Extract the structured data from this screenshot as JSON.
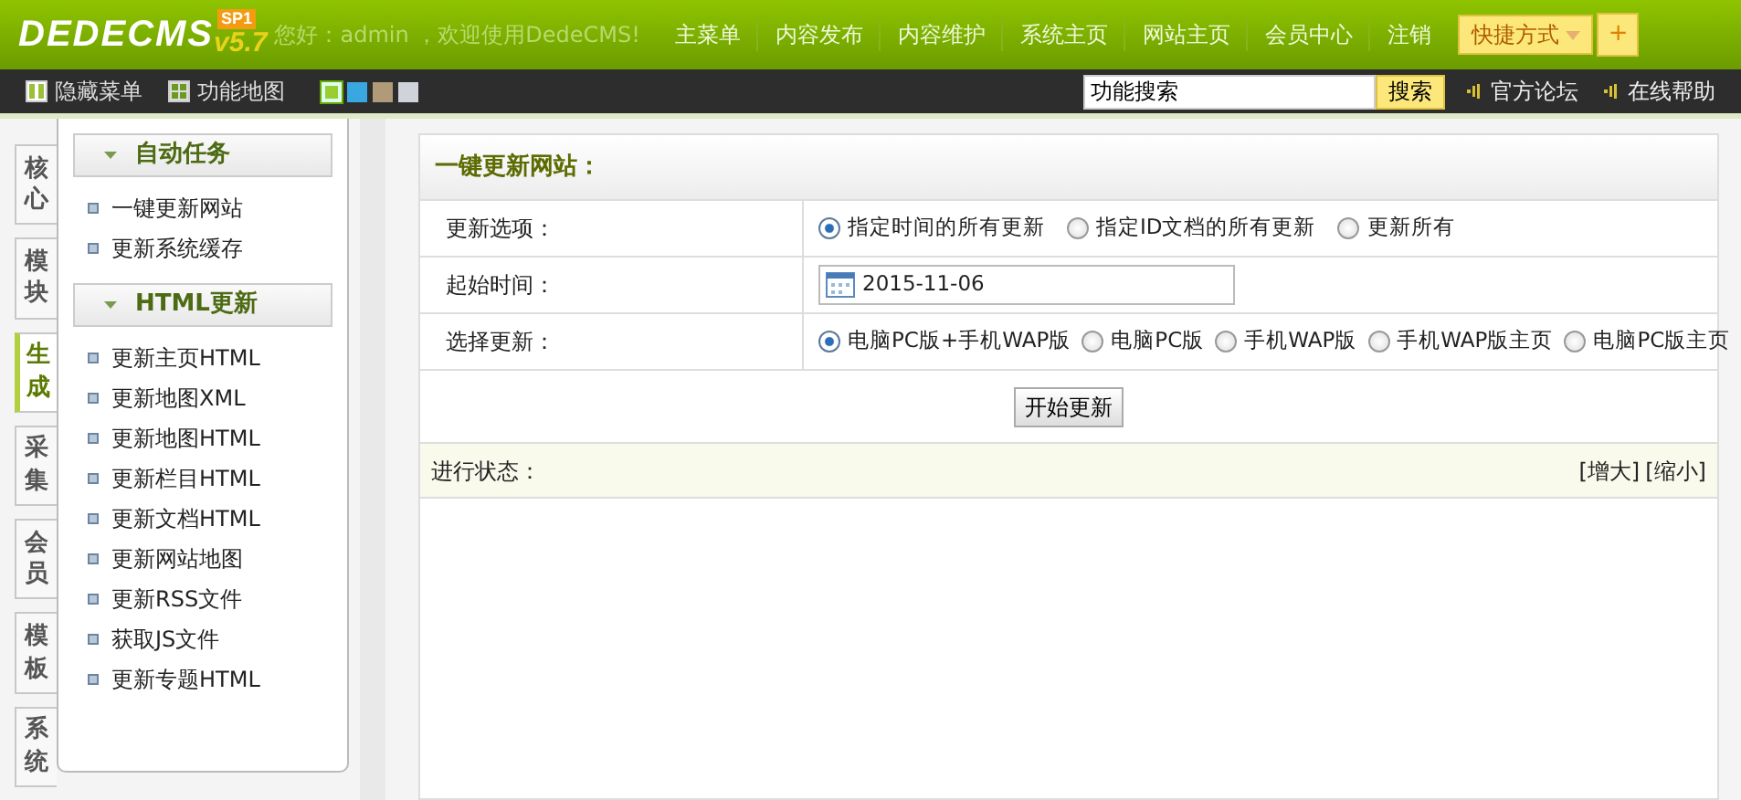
{
  "header": {
    "logo": "DEDECMS",
    "version": "v5.7",
    "badge": "SP1",
    "welcome": "您好：admin ，欢迎使用DedeCMS!",
    "nav": [
      "主菜单",
      "内容发布",
      "内容维护",
      "系统主页",
      "网站主页",
      "会员中心",
      "注销"
    ],
    "shortcut": "快捷方式",
    "shortcut_add": "+"
  },
  "toolbar": {
    "items": [
      "隐藏菜单",
      "功能地图"
    ],
    "swatches": [
      {
        "color": "#9acd32",
        "selected": true
      },
      {
        "color": "#3aa8e0",
        "selected": false
      },
      {
        "color": "#b09a78",
        "selected": false
      },
      {
        "color": "#d0d4da",
        "selected": false
      }
    ],
    "search": {
      "value": "功能搜索",
      "button": "搜索"
    },
    "links": [
      "官方论坛",
      "在线帮助"
    ]
  },
  "side_tabs": [
    {
      "label": "核心",
      "selected": false
    },
    {
      "label": "模块",
      "selected": false
    },
    {
      "label": "生成",
      "selected": true
    },
    {
      "label": "采集",
      "selected": false
    },
    {
      "label": "会员",
      "selected": false
    },
    {
      "label": "模板",
      "selected": false
    },
    {
      "label": "系统",
      "selected": false
    }
  ],
  "sidebar": [
    {
      "title": "自动任务",
      "items": [
        "一键更新网站",
        "更新系统缓存"
      ]
    },
    {
      "title": "HTML更新",
      "items": [
        "更新主页HTML",
        "更新地图XML",
        "更新地图HTML",
        "更新栏目HTML",
        "更新文档HTML",
        "更新网站地图",
        "更新RSS文件",
        "获取JS文件",
        "更新专题HTML"
      ]
    }
  ],
  "form": {
    "title": "一键更新网站：",
    "rows": [
      {
        "kind": "radio",
        "label": "更新选项：",
        "options": [
          {
            "label": "指定时间的所有更新",
            "selected": true
          },
          {
            "label": "指定ID文档的所有更新",
            "selected": false
          },
          {
            "label": "更新所有",
            "selected": false
          }
        ]
      },
      {
        "kind": "date",
        "label": "起始时间：",
        "value": "2015-11-06"
      },
      {
        "kind": "radio",
        "label": "选择更新：",
        "options": [
          {
            "label": "电脑PC版+手机WAP版",
            "selected": true
          },
          {
            "label": "电脑PC版",
            "selected": false
          },
          {
            "label": "手机WAP版",
            "selected": false
          },
          {
            "label": "手机WAP版主页",
            "selected": false
          },
          {
            "label": "电脑PC版主页",
            "selected": false
          }
        ]
      }
    ],
    "button": "开始更新",
    "status_label": "进行状态：",
    "status_links": [
      "[增大]",
      "[缩小]"
    ]
  }
}
